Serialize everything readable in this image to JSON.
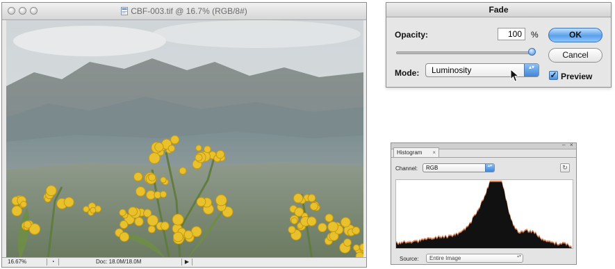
{
  "document": {
    "title": "CBF-003.tif @ 16.7% (RGB/8#)",
    "zoom": "16.67%",
    "doc_info": "Doc: 18.0M/18.0M",
    "status_arrow": "▶",
    "status_icon": "◔"
  },
  "fade_dialog": {
    "title": "Fade",
    "opacity_label": "Opacity:",
    "opacity_value": "100",
    "percent_sign": "%",
    "slider_value_percent": 100,
    "mode_label": "Mode:",
    "mode_value": "Luminosity",
    "ok_label": "OK",
    "cancel_label": "Cancel",
    "preview_label": "Preview",
    "preview_checked": true,
    "preview_check_glyph": "✓",
    "ok_color": "#5aa0ea"
  },
  "histogram": {
    "tab_label": "Histogram",
    "tab_close": "×",
    "channel_label": "Channel:",
    "channel_value": "RGB",
    "source_label": "Source:",
    "source_value": "Entire Image",
    "refresh_glyph": "↻",
    "arrows_glyph": "▴▾",
    "palette_min": "–",
    "palette_close": "×",
    "fill_color": "#111111",
    "edge_color": "#e0804e"
  },
  "icons": {
    "traffic_lights": [
      "close-button-icon",
      "minimize-button-icon",
      "zoom-button-icon"
    ],
    "mode_arrows": "▴▾"
  }
}
